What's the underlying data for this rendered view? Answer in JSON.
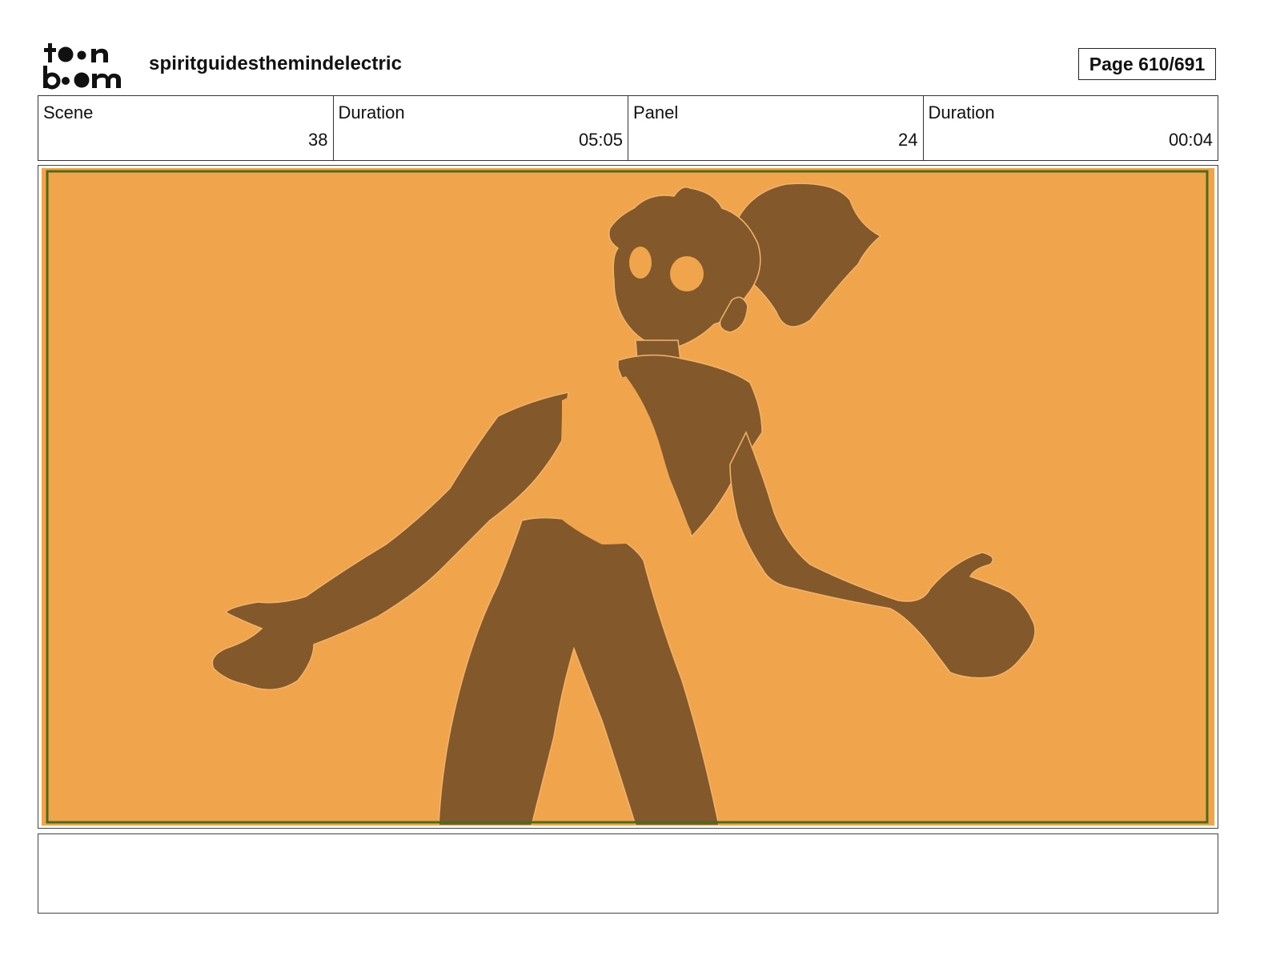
{
  "header": {
    "logo_text_top": "toon",
    "logo_text_bottom": "boom",
    "project_title": "spiritguidesthemindelectric",
    "page_label": "Page 610/691"
  },
  "info": [
    {
      "label": "Scene",
      "value": "38"
    },
    {
      "label": "Duration",
      "value": "05:05"
    },
    {
      "label": "Panel",
      "value": "24"
    },
    {
      "label": "Duration",
      "value": "00:04"
    }
  ],
  "panel": {
    "background_color": "#f0a44b",
    "silhouette_color": "#83582a",
    "safe_frame_color": "#4f6a1a",
    "image_description_icon": "character-silhouette"
  },
  "notes": {
    "text": ""
  }
}
